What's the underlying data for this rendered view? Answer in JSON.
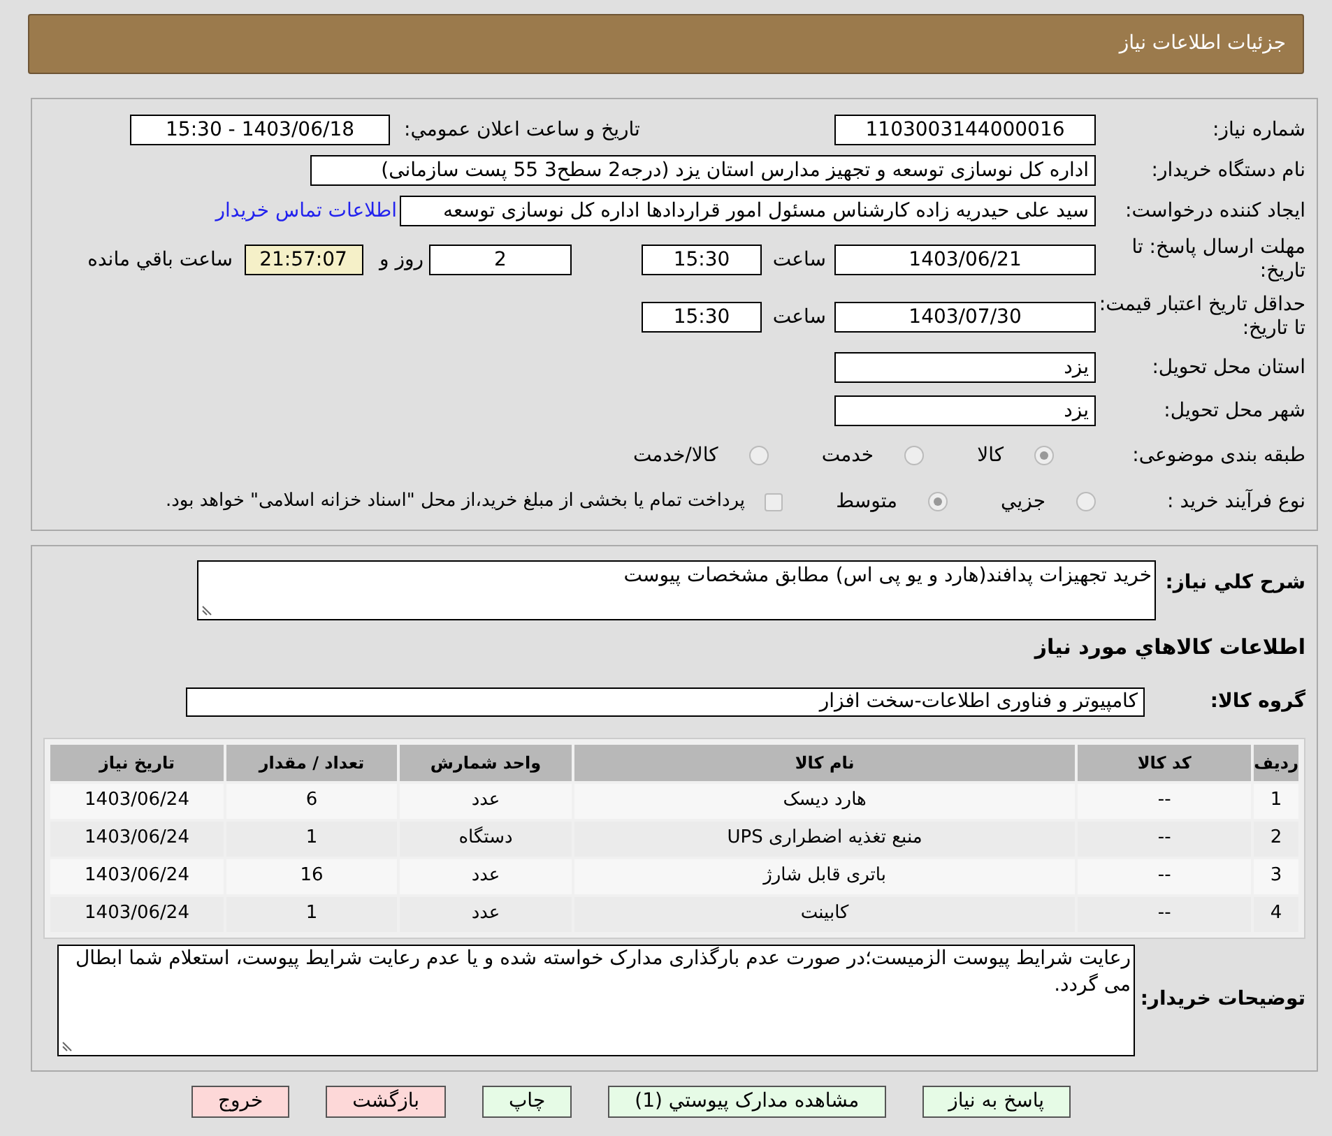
{
  "header": {
    "title": "جزئیات اطلاعات نیاز"
  },
  "fields": {
    "need_number": {
      "label": "شماره نیاز:",
      "value": "1103003144000016"
    },
    "announce": {
      "label": "تاریخ و ساعت اعلان عمومي:",
      "value": "1403/06/18 - 15:30"
    },
    "buyer": {
      "label": "نام دستگاه خریدار:",
      "value": "اداره کل نوسازی   توسعه و تجهیز مدارس استان یزد (درجه2  سطح3  55 پست سازمانی)"
    },
    "creator": {
      "label": "ایجاد کننده درخواست:",
      "value": "سید علی حیدریه زاده کارشناس مسئول امور قراردادها اداره کل نوسازی   توسعه",
      "link": "اطلاعات تماس خریدار"
    },
    "deadline": {
      "label": "مهلت ارسال پاسخ: تا تاریخ:",
      "date": "1403/06/21",
      "time_label": "ساعت",
      "time": "15:30",
      "days": "2",
      "days_label": "روز و",
      "remaining": "21:57:07",
      "remaining_label": "ساعت باقي مانده"
    },
    "validity": {
      "label": "حداقل تاریخ اعتبار قیمت: تا تاریخ:",
      "date": "1403/07/30",
      "time_label": "ساعت",
      "time": "15:30"
    },
    "province": {
      "label": "استان محل تحویل:",
      "value": "یزد"
    },
    "city": {
      "label": "شهر محل تحویل:",
      "value": "یزد"
    }
  },
  "category": {
    "label": "طبقه بندی موضوعی:",
    "options": [
      {
        "label": "کالا",
        "selected": true
      },
      {
        "label": "خدمت",
        "selected": false
      },
      {
        "label": "کالا/خدمت",
        "selected": false
      }
    ]
  },
  "process": {
    "label": "نوع فرآیند خرید :",
    "options": [
      {
        "label": "جزيي",
        "selected": false
      },
      {
        "label": "متوسط",
        "selected": true
      }
    ],
    "treasury": {
      "label": "پرداخت تمام یا بخشی از مبلغ خرید،از محل \"اسناد خزانه اسلامی\" خواهد بود.",
      "checked": false
    }
  },
  "summary": {
    "label": "شرح کلي نیاز:",
    "value": "خرید تجهیزات پدافند(هارد و یو پی اس) مطابق مشخصات پیوست"
  },
  "goods_heading": "اطلاعات کالاهاي مورد نیاز",
  "goods_group": {
    "label": "گروه کالا:",
    "value": "کامپیوتر و فناوری اطلاعات-سخت افزار"
  },
  "table": {
    "columns": [
      "ردیف",
      "کد کالا",
      "نام کالا",
      "واحد شمارش",
      "تعداد / مقدار",
      "تاریخ نیاز"
    ],
    "rows": [
      [
        "1",
        "--",
        "هارد دیسک",
        "عدد",
        "6",
        "1403/06/24"
      ],
      [
        "2",
        "--",
        "منبع تغذیه اضطراری UPS",
        "دستگاه",
        "1",
        "1403/06/24"
      ],
      [
        "3",
        "--",
        "باتری قابل شارژ",
        "عدد",
        "16",
        "1403/06/24"
      ],
      [
        "4",
        "--",
        "کابینت",
        "عدد",
        "1",
        "1403/06/24"
      ]
    ]
  },
  "buyer_notes": {
    "label": "توضیحات خریدار:",
    "value": "رعایت شرایط پیوست الزمیست؛در صورت عدم بارگذاری مدارک خواسته شده و یا عدم رعایت شرایط پیوست، استعلام شما ابطال می گردد."
  },
  "buttons": [
    {
      "label": "پاسخ به نیاز",
      "kind": "normal"
    },
    {
      "label": "مشاهده مدارک پیوستي (1)",
      "kind": "normal"
    },
    {
      "label": "چاپ",
      "kind": "normal"
    },
    {
      "label": "بازگشت",
      "kind": "danger"
    },
    {
      "label": "خروج",
      "kind": "danger"
    }
  ]
}
